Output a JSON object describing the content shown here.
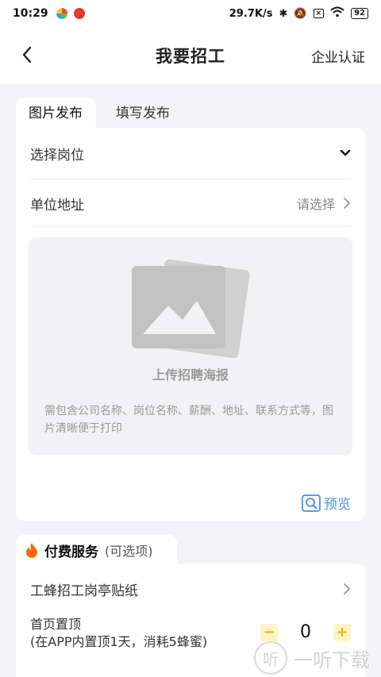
{
  "status_bar": {
    "time": "10:29",
    "net_speed": "29.7K/s",
    "battery": "92"
  },
  "nav": {
    "title": "我要招工",
    "right_label": "企业认证"
  },
  "tabs": [
    {
      "label": "图片发布",
      "active": true
    },
    {
      "label": "填写发布",
      "active": false
    }
  ],
  "form": {
    "job_label": "选择岗位",
    "address_label": "单位地址",
    "address_placeholder": "请选择"
  },
  "upload": {
    "title": "上传招聘海报",
    "hint": "需包含公司名称、岗位名称、薪酬、地址、联系方式等，图片清晰便于打印"
  },
  "preview_label": "预览",
  "service": {
    "title": "付费服务",
    "subtitle": "(可选项)",
    "item1": "工蜂招工岗亭贴纸",
    "item2_line1": "首页置顶",
    "item2_line2": "(在APP内置顶1天，消耗5蜂蜜)",
    "stepper_minus": "−",
    "stepper_value": "0",
    "stepper_plus": "+"
  },
  "watermark": {
    "icon_char": "听",
    "text": "一听下载"
  },
  "colors": {
    "accent_blue": "#4a90e2",
    "stepper_yellow": "#f2b400",
    "fire_orange": "#ff6a00"
  }
}
